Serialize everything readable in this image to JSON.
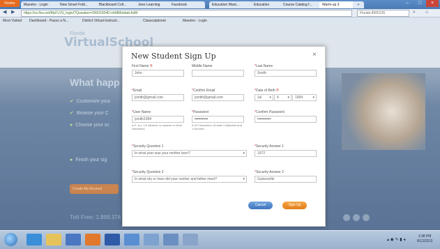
{
  "browser": {
    "firefox_label": "Firefox",
    "tabs": [
      "Maestro - Login",
      "New Smart Fold...",
      "Blackboard Coll...",
      "Joes Learning",
      "Facebook",
      "Education Wast...",
      "Education",
      "Course Catalog f...",
      "Warm-up 3"
    ],
    "new_tab": "+",
    "url": "https://vs.flvs.net/MyFLVS_login/?Question=20001504D+rhMMoldatv.folM",
    "search_placeholder": "Florida 8500125",
    "bookmarks": [
      "Most Visited",
      "Dashboard - Passo a N...",
      "District Virtual Instructi...",
      "Classcatalonet",
      "Maestro - Login"
    ],
    "window_controls": [
      "–",
      "□",
      "×"
    ]
  },
  "background_page": {
    "logo_small": "Florida",
    "logo": "VirtualSchool",
    "heading": "What happ",
    "items": [
      "Customize your",
      "Browse your C",
      "Choose your sc",
      "Finish your sig"
    ],
    "toll_free": "Toll Free: 1.800.374",
    "cta": "Create My Account"
  },
  "modal": {
    "title": "New Student Sign Up",
    "close": "×",
    "fields": {
      "first_name": {
        "label": "First Name",
        "value": "John"
      },
      "middle_name": {
        "label": "Middle Name",
        "value": ""
      },
      "last_name": {
        "label": "Last Name",
        "value": "Smith"
      },
      "email": {
        "label": "Email",
        "value": "jsmith@gmail.com"
      },
      "confirm_email": {
        "label": "Confirm Email",
        "value": "jsmith@gmail.com"
      },
      "dob": {
        "label": "Date of Birth",
        "month": "Jul",
        "day": "4",
        "year": "1994"
      },
      "user_name": {
        "label": "User Name",
        "value": "jsmith1994",
        "hint": "A-Z, a-z, 0-9 allowed, no spaces or other characters"
      },
      "password": {
        "label": "Password",
        "value": "•••••••••••",
        "hint": "6-32 Characters, At least 1 Alphabet and 1 Numeric"
      },
      "confirm_password": {
        "label": "Confirm Password",
        "value": "•••••••••••"
      },
      "security_q1": {
        "label": "Security Question 1",
        "value": "In what year was your mother born?"
      },
      "security_a1": {
        "label": "Security Answer 1",
        "value": "1972"
      },
      "security_q2": {
        "label": "Security Question 2",
        "value": "In what city or town did your mother and father meet?"
      },
      "security_a2": {
        "label": "Security Answer 2",
        "value": "Gainesville"
      }
    },
    "cancel": "Cancel",
    "signup": "Sign Up"
  },
  "taskbar": {
    "time": "3:38 PM",
    "date": "8/12/2013"
  },
  "colors": {
    "cancel": "#3e74bd",
    "signup": "#e27d17",
    "required": "#cc3333"
  }
}
